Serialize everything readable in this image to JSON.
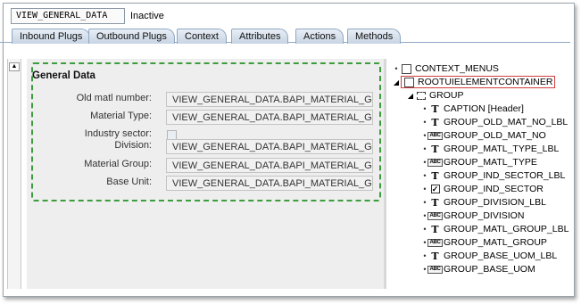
{
  "header": {
    "view_name": "VIEW_GENERAL_DATA",
    "status": "Inactive"
  },
  "tabs": [
    {
      "label": "Inbound Plugs"
    },
    {
      "label": "Outbound Plugs"
    },
    {
      "label": "Context"
    },
    {
      "label": "Attributes"
    },
    {
      "label": "Actions"
    },
    {
      "label": "Methods"
    }
  ],
  "layout_preview": {
    "group_title": "General Data",
    "fields": [
      {
        "label": "Old matl number:",
        "value": "VIEW_GENERAL_DATA.BAPI_MATERIAL_GET_D"
      },
      {
        "label": "Material Type:",
        "value": "VIEW_GENERAL_DATA.BAPI_MATERIAL_GET_D"
      },
      {
        "label": "Industry sector:",
        "value": ""
      },
      {
        "label": "Division:",
        "value": "VIEW_GENERAL_DATA.BAPI_MATERIAL_GET_D"
      },
      {
        "label": "Material Group:",
        "value": "VIEW_GENERAL_DATA.BAPI_MATERIAL_GET_D"
      },
      {
        "label": "Base Unit:",
        "value": "VIEW_GENERAL_DATA.BAPI_MATERIAL_GET_D"
      }
    ]
  },
  "tree": {
    "nodes": [
      {
        "text": "CONTEXT_MENUS",
        "icon": "container-icon"
      },
      {
        "text": "ROOTUIELEMENTCONTAINER",
        "icon": "container-icon"
      },
      {
        "text": "GROUP",
        "icon": "group-icon"
      },
      {
        "text": "CAPTION  [Header]",
        "icon": "caption-icon"
      },
      {
        "text": "GROUP_OLD_MAT_NO_LBL",
        "icon": "label-icon"
      },
      {
        "text": "GROUP_OLD_MAT_NO",
        "icon": "input-field-icon"
      },
      {
        "text": "GROUP_MATL_TYPE_LBL",
        "icon": "label-icon"
      },
      {
        "text": "GROUP_MATL_TYPE",
        "icon": "input-field-icon"
      },
      {
        "text": "GROUP_IND_SECTOR_LBL",
        "icon": "label-icon"
      },
      {
        "text": "GROUP_IND_SECTOR",
        "icon": "checkbox-icon"
      },
      {
        "text": "GROUP_DIVISION_LBL",
        "icon": "label-icon"
      },
      {
        "text": "GROUP_DIVISION",
        "icon": "input-field-icon"
      },
      {
        "text": "GROUP_MATL_GROUP_LBL",
        "icon": "label-icon"
      },
      {
        "text": "GROUP_MATL_GROUP",
        "icon": "input-field-icon"
      },
      {
        "text": "GROUP_BASE_UOM_LBL",
        "icon": "label-icon"
      },
      {
        "text": "GROUP_BASE_UOM",
        "icon": "input-field-icon"
      }
    ]
  },
  "icons": {
    "abc": "ABC"
  },
  "colors": {
    "group_border": "#3d9c3d",
    "selection_border": "#d23d3d"
  }
}
